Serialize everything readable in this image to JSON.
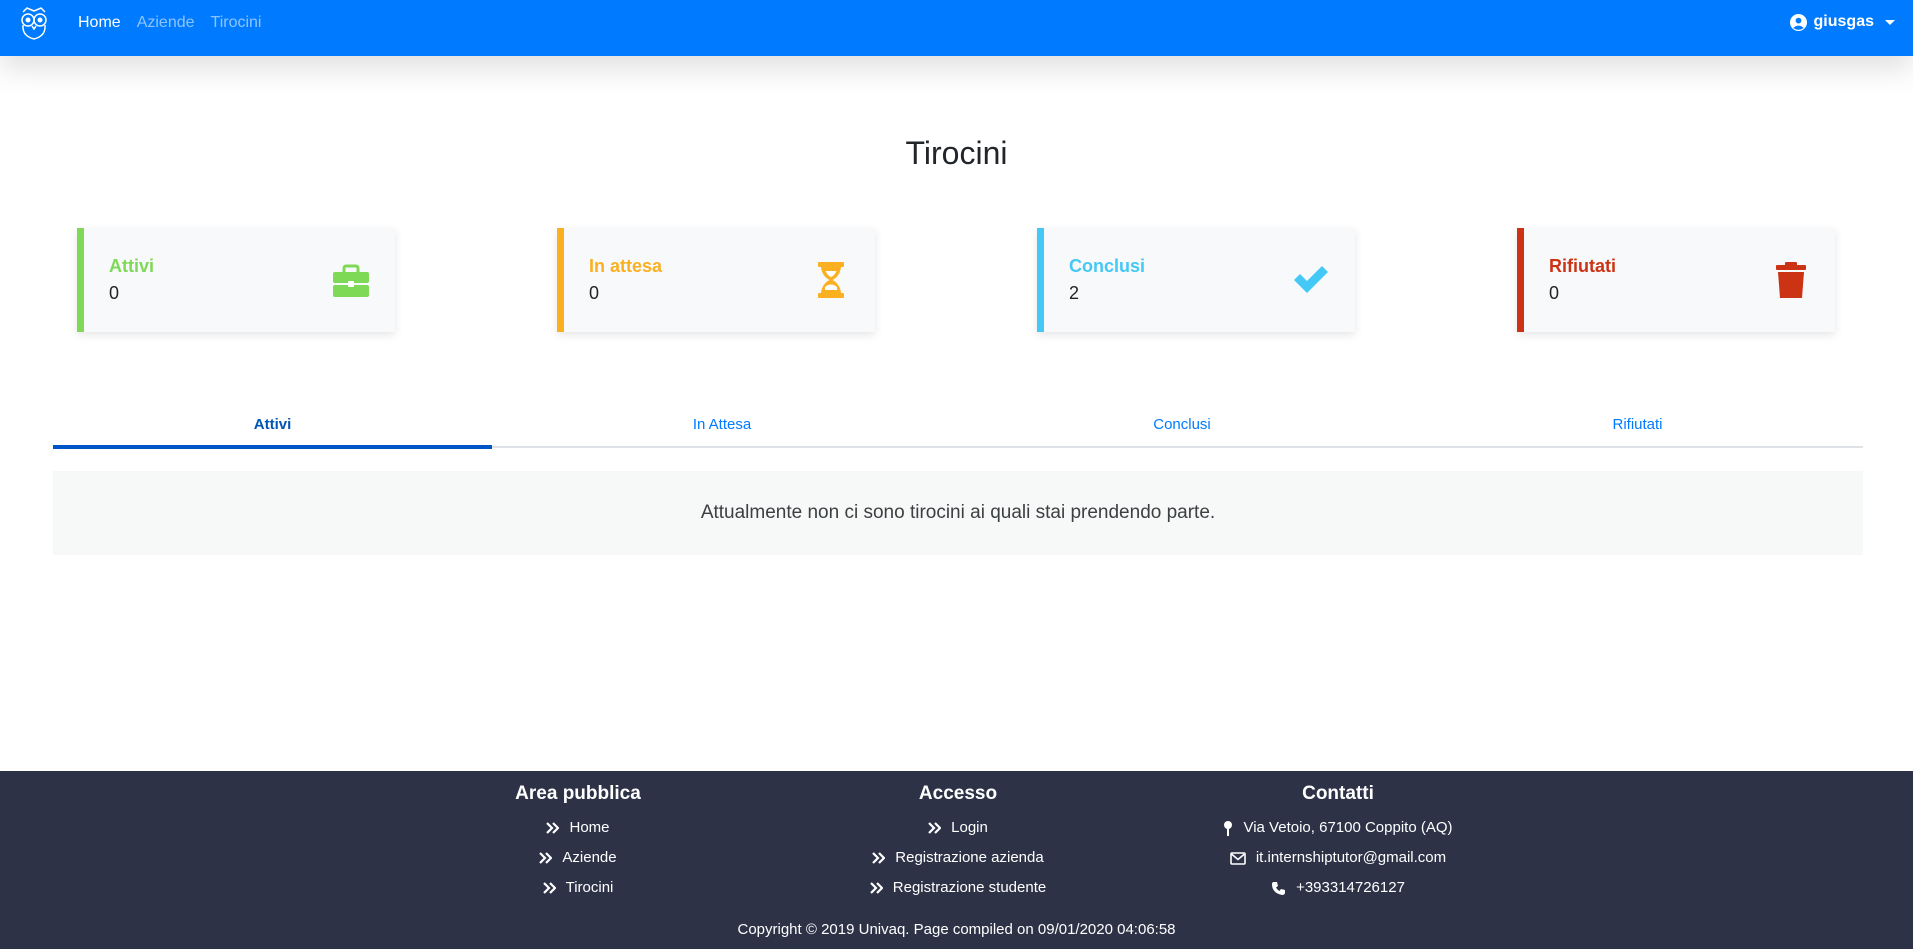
{
  "navbar": {
    "links": [
      {
        "label": "Home",
        "active": true
      },
      {
        "label": "Aziende",
        "active": false
      },
      {
        "label": "Tirocini",
        "active": false
      }
    ],
    "user": "giusgas",
    "logo_icon": "owl-logo-icon",
    "brand_color": "#007bff"
  },
  "page": {
    "title": "Tirocini"
  },
  "stats": [
    {
      "label": "Attivi",
      "count": "0",
      "color": "#7ed957",
      "icon": "briefcase-icon"
    },
    {
      "label": "In attesa",
      "count": "0",
      "color": "#fbb021",
      "icon": "hourglass-icon"
    },
    {
      "label": "Conclusi",
      "count": "2",
      "color": "#44c8f5",
      "icon": "check-icon"
    },
    {
      "label": "Rifiutati",
      "count": "0",
      "color": "#cc3314",
      "icon": "trash-icon"
    }
  ],
  "tabs": [
    {
      "label": "Attivi",
      "active": true
    },
    {
      "label": "In Attesa",
      "active": false
    },
    {
      "label": "Conclusi",
      "active": false
    },
    {
      "label": "Rifiutati",
      "active": false
    }
  ],
  "empty_message": "Attualmente non ci sono tirocini ai quali stai prendendo parte.",
  "footer": {
    "area_pubblica": {
      "title": "Area pubblica",
      "items": [
        "Home",
        "Aziende",
        "Tirocini"
      ]
    },
    "accesso": {
      "title": "Accesso",
      "items": [
        "Login",
        "Registrazione azienda",
        "Registrazione studente"
      ]
    },
    "contatti": {
      "title": "Contatti",
      "address": "Via Vetoio, 67100 Coppito (AQ)",
      "email": "it.internshiptutor@gmail.com",
      "phone": "+393314726127"
    },
    "copyright": "Copyright © 2019 Univaq. Page compiled on 09/01/2020 04:06:58",
    "background": "#2d3247"
  }
}
